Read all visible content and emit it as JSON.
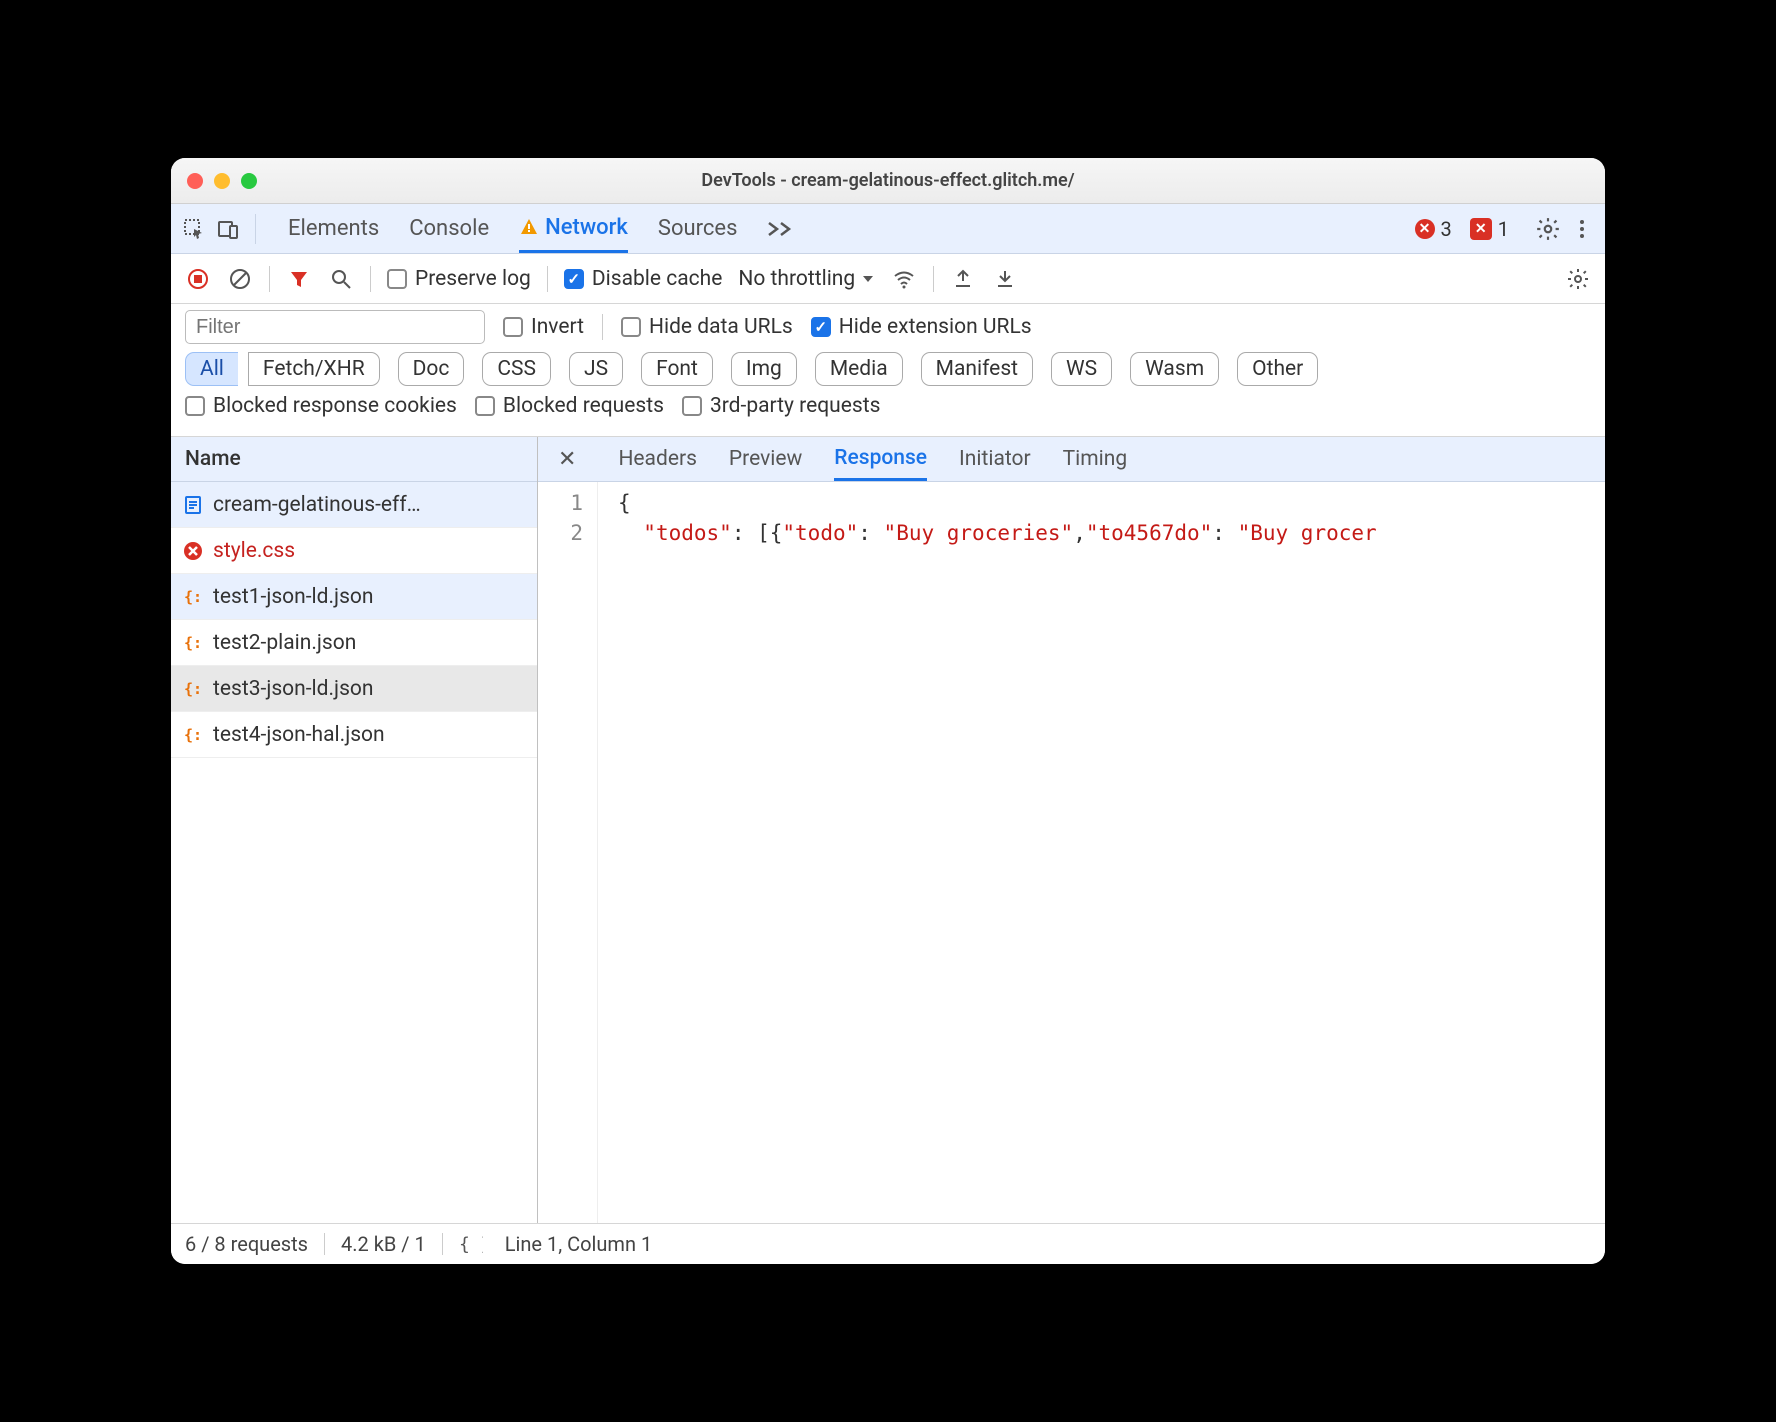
{
  "window": {
    "title": "DevTools - cream-gelatinous-effect.glitch.me/"
  },
  "panelTabs": {
    "elements": "Elements",
    "console": "Console",
    "network": "Network",
    "sources": "Sources"
  },
  "errors": {
    "count": "3",
    "issues": "1"
  },
  "toolbar": {
    "preserveLog": "Preserve log",
    "disableCache": "Disable cache",
    "throttling": "No throttling"
  },
  "filter": {
    "placeholder": "Filter",
    "invert": "Invert",
    "hideDataUrls": "Hide data URLs",
    "hideExtUrls": "Hide extension URLs",
    "types": [
      "All",
      "Fetch/XHR",
      "Doc",
      "CSS",
      "JS",
      "Font",
      "Img",
      "Media",
      "Manifest",
      "WS",
      "Wasm",
      "Other"
    ],
    "blockedCookies": "Blocked response cookies",
    "blockedRequests": "Blocked requests",
    "thirdParty": "3rd-party requests"
  },
  "requests": {
    "header": "Name",
    "items": [
      {
        "name": "cream-gelatinous-eff…",
        "icon": "doc",
        "state": "sel"
      },
      {
        "name": "style.css",
        "icon": "err",
        "state": "err"
      },
      {
        "name": "test1-json-ld.json",
        "icon": "json",
        "state": "sel"
      },
      {
        "name": "test2-plain.json",
        "icon": "json",
        "state": ""
      },
      {
        "name": "test3-json-ld.json",
        "icon": "json",
        "state": "hov"
      },
      {
        "name": "test4-json-hal.json",
        "icon": "json",
        "state": ""
      }
    ]
  },
  "detailTabs": {
    "headers": "Headers",
    "preview": "Preview",
    "response": "Response",
    "initiator": "Initiator",
    "timing": "Timing"
  },
  "response": {
    "lines": [
      "1",
      "2"
    ],
    "line1": "{",
    "line2_k1": "\"todos\"",
    "line2_p1": ": [{",
    "line2_k2": "\"todo\"",
    "line2_p2": ": ",
    "line2_v1": "\"Buy groceries\"",
    "line2_p3": ",",
    "line2_k3": "\"to4567do\"",
    "line2_p4": ": ",
    "line2_v2": "\"Buy grocer"
  },
  "status": {
    "requests": "6 / 8 requests",
    "transfer": "4.2 kB / 1",
    "cursor": "Line 1, Column 1"
  }
}
